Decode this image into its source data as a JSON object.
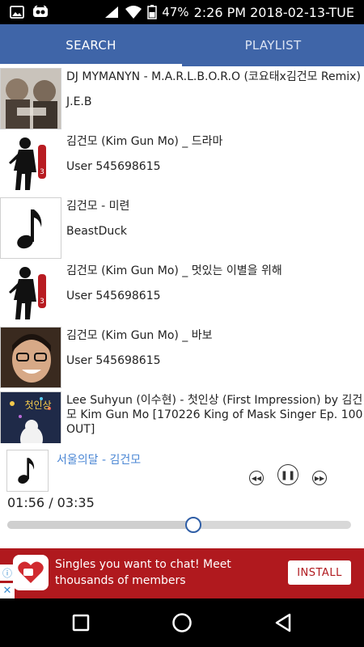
{
  "status_bar": {
    "battery": "47%",
    "clock": "2:26 PM 2018-02-13-TUE"
  },
  "tabs": [
    {
      "label": "SEARCH",
      "active": true
    },
    {
      "label": "PLAYLIST",
      "active": false
    }
  ],
  "songs": [
    {
      "title": "DJ MYMANYN - M.A.R.L.B.O.R.O (코요태x김건모 Remix)",
      "artist": "J.E.B",
      "thumb": "album-art-icon"
    },
    {
      "title": "김건모 (Kim Gun Mo) _ 드라마",
      "artist": "User 545698615",
      "thumb": "artist-silhouette-icon"
    },
    {
      "title": "김건모 - 미련",
      "artist": "BeastDuck",
      "thumb": "music-note-icon"
    },
    {
      "title": "김건모 (Kim Gun Mo) _ 멋있는 이별을 위해",
      "artist": "User 545698615",
      "thumb": "artist-silhouette-icon"
    },
    {
      "title": "김건모 (Kim Gun Mo) _ 바보",
      "artist": "User 545698615",
      "thumb": "artist-photo-icon"
    },
    {
      "title": "Lee Suhyun (이수현) - 첫인상 (First Impression) by 김건모 Kim Gun Mo [170226 King of Mask Singer Ep. 100 OUT]",
      "artist": "",
      "thumb": "album-art-icon"
    }
  ],
  "player": {
    "now_playing": "서울의달 - 김건모",
    "elapsed": "01:56",
    "duration": "03:35",
    "time_display": "01:56 / 03:35",
    "progress_fraction": 0.54
  },
  "ad": {
    "text": "Singles you want to chat! Meet thousands of members",
    "install_label": "INSTALL",
    "info_icon": "info-icon",
    "close_icon": "close-icon"
  },
  "colors": {
    "tab_bar": "#3f65a8",
    "accent_blue": "#4a86d4",
    "ad_red": "#b0191e"
  }
}
